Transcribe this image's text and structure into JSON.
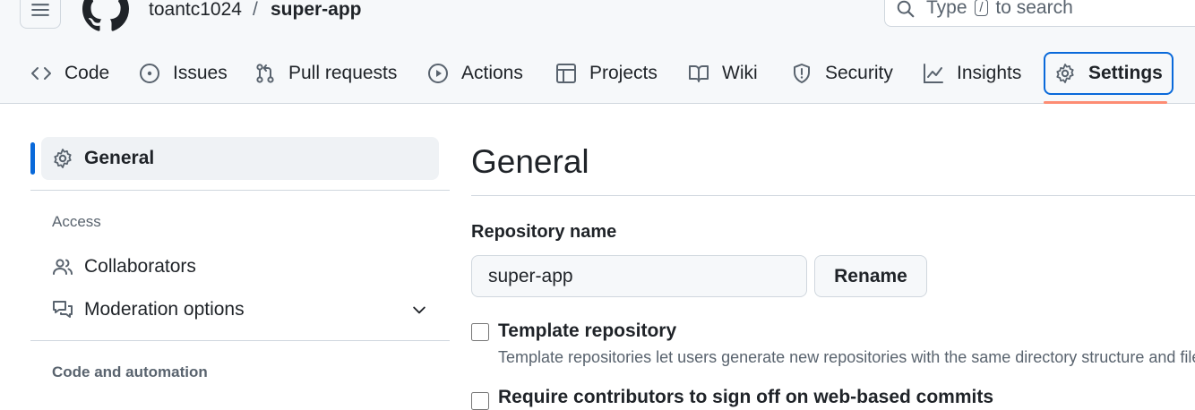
{
  "header": {
    "owner": "toantc1024",
    "separator": "/",
    "repo": "super-app",
    "search": {
      "before": "Type",
      "key": "/",
      "after": "to search"
    }
  },
  "tabs": [
    {
      "label": "Code",
      "icon": "code-icon"
    },
    {
      "label": "Issues",
      "icon": "issue-icon"
    },
    {
      "label": "Pull requests",
      "icon": "pull-request-icon"
    },
    {
      "label": "Actions",
      "icon": "play-icon"
    },
    {
      "label": "Projects",
      "icon": "table-icon"
    },
    {
      "label": "Wiki",
      "icon": "book-icon"
    },
    {
      "label": "Security",
      "icon": "shield-icon"
    },
    {
      "label": "Insights",
      "icon": "graph-icon"
    },
    {
      "label": "Settings",
      "icon": "gear-icon",
      "active": true
    }
  ],
  "sidebar": {
    "general": "General",
    "access_heading": "Access",
    "collaborators": "Collaborators",
    "moderation": "Moderation options",
    "code_heading": "Code and automation"
  },
  "main": {
    "title": "General",
    "repo_name_label": "Repository name",
    "repo_name_value": "super-app",
    "rename_label": "Rename",
    "template_label": "Template repository",
    "template_desc": "Template repositories let users generate new repositories with the same directory structure and files.",
    "next_label": "Require contributors to sign off on web-based commits"
  },
  "colors": {
    "accent": "#0969da",
    "underline": "#fd8c73",
    "header_bg": "#f6f8fa",
    "border": "#d0d7de",
    "muted_text": "#59636e"
  }
}
